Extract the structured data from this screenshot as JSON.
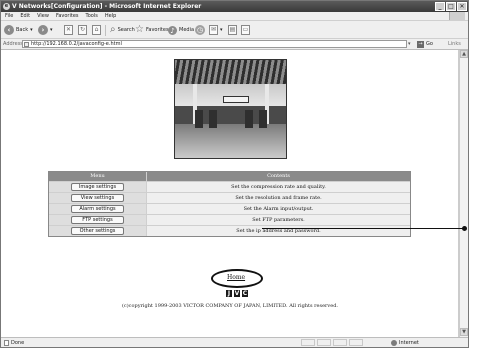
{
  "window": {
    "title": "V Networks[Configuration] - Microsoft Internet Explorer",
    "controls": [
      "_",
      "□",
      "✕"
    ]
  },
  "menubar": {
    "items": [
      "File",
      "Edit",
      "View",
      "Favorites",
      "Tools",
      "Help"
    ]
  },
  "toolbar": {
    "back_label": "Back",
    "search_label": "Search",
    "favorites_label": "Favorites",
    "media_label": "Media"
  },
  "address": {
    "label": "Address",
    "url": "http://192.168.0.2/javaconfig-e.html",
    "go_label": "Go",
    "links_label": "Links"
  },
  "menu_table": {
    "header_menu": "Menu",
    "header_contents": "Contents",
    "rows": [
      {
        "button": "Image settings",
        "description": "Set the compression rate and quality."
      },
      {
        "button": "View settings",
        "description": "Set the resolution and frame rate."
      },
      {
        "button": "Alarm settings",
        "description": "Set the Alarm input/output."
      },
      {
        "button": "FTP settings",
        "description": "Set FTP parameters."
      },
      {
        "button": "Other settings",
        "description": "Set the ip address and password."
      }
    ]
  },
  "home_link": "Home",
  "logo_letters": [
    "J",
    "V",
    "C"
  ],
  "copyright": "(c)copyright 1999-2003 VICTOR COMPANY OF JAPAN, LIMITED. All rights reserved.",
  "status": {
    "left": "Done",
    "zone": "Internet"
  }
}
